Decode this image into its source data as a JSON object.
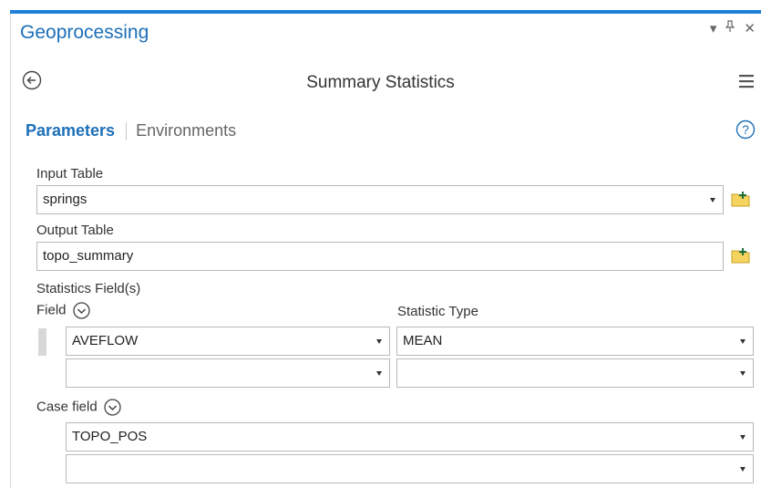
{
  "pane": {
    "title": "Geoprocessing",
    "accent_color": "#1f7fd4",
    "window_controls": [
      "dropdown-icon",
      "pin-icon",
      "close-icon"
    ]
  },
  "tool": {
    "title": "Summary Statistics",
    "back_icon": "back-arrow-icon",
    "menu_icon": "hamburger-menu-icon"
  },
  "tabs": {
    "active": "Parameters",
    "inactive": "Environments",
    "help_icon": "help-icon"
  },
  "params": {
    "input_table": {
      "label": "Input Table",
      "value": "springs",
      "browse_icon": "add-folder-icon"
    },
    "output_table": {
      "label": "Output Table",
      "value": "topo_summary",
      "browse_icon": "add-folder-icon"
    },
    "statistics": {
      "label": "Statistics Field(s)",
      "field_header": "Field",
      "type_header": "Statistic Type",
      "rows": [
        {
          "field": "AVEFLOW",
          "type": "MEAN"
        },
        {
          "field": "",
          "type": ""
        }
      ]
    },
    "case_field": {
      "label": "Case field",
      "rows": [
        "TOPO_POS",
        ""
      ]
    }
  }
}
